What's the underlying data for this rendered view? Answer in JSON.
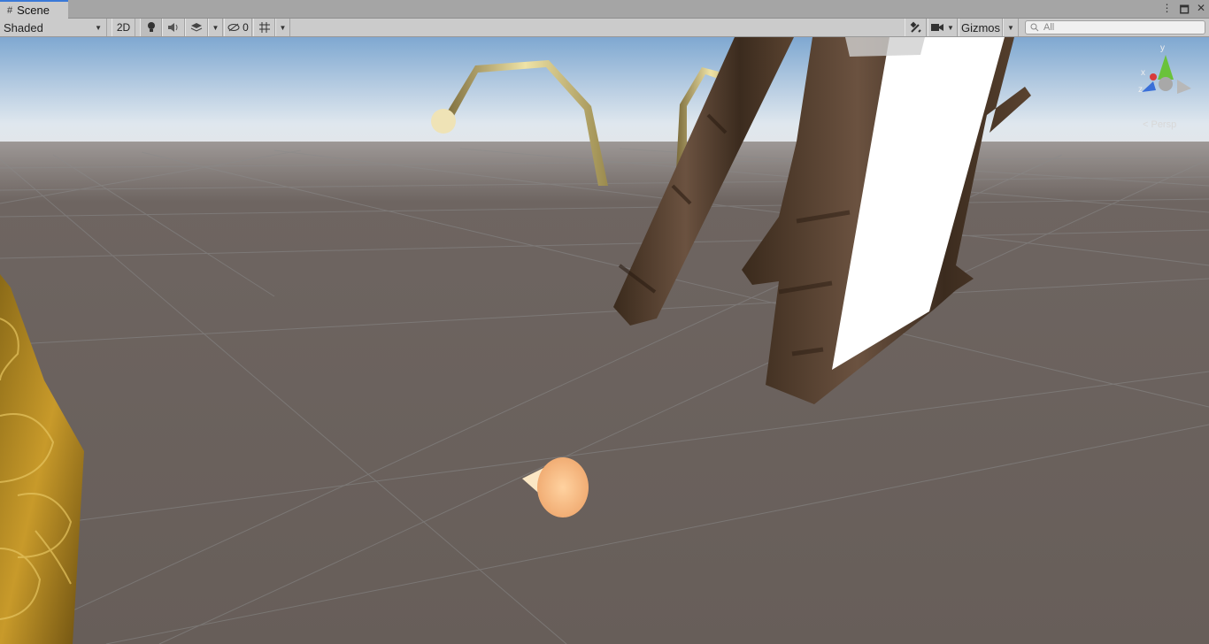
{
  "tab": {
    "title": "Scene",
    "icon": "grid-icon"
  },
  "window_controls": {
    "menu": "⋮",
    "maximize": "🗖",
    "close": "✕"
  },
  "toolbar": {
    "shading_mode": "Shaded",
    "toggle_2d": "2D",
    "hidden_count": "0",
    "gizmos": "Gizmos"
  },
  "search": {
    "placeholder": "All"
  },
  "gizmo": {
    "x": "x",
    "y": "y",
    "z": "z",
    "projection": "< Persp"
  },
  "colors": {
    "accent": "#3a79d8",
    "ground": "#6b625d",
    "sky_top": "#8fb3d6",
    "wood": "#4a3524"
  }
}
